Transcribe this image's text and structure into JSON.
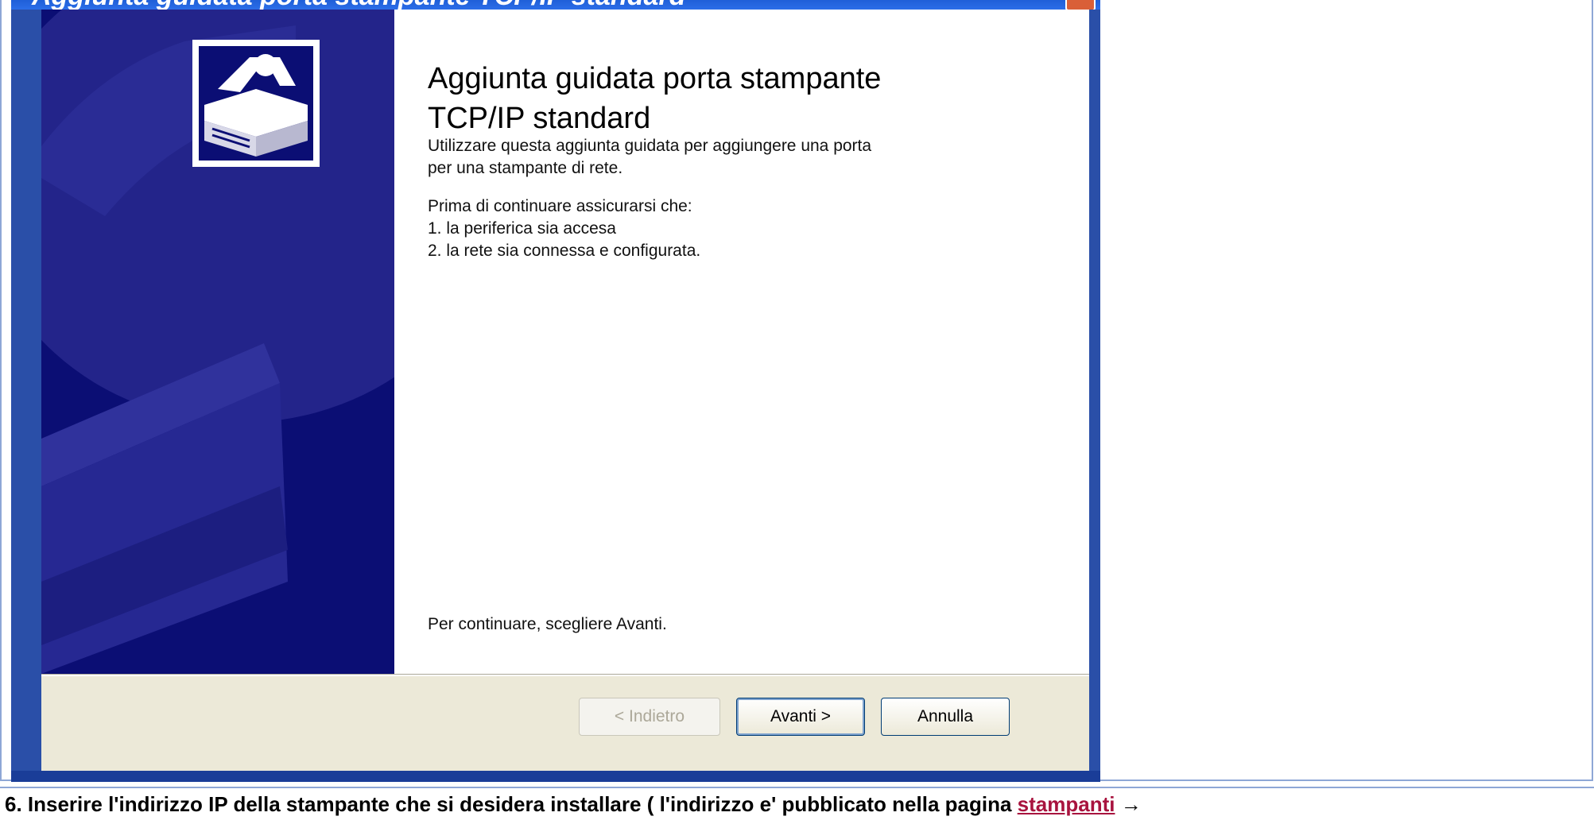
{
  "window": {
    "title": "Aggiunta guidata porta stampante TCP/IP standard"
  },
  "wizard": {
    "heading_line1": "Aggiunta guidata porta stampante",
    "heading_line2": "TCP/IP standard",
    "intro_line1": "Utilizzare questa aggiunta guidata per aggiungere una porta",
    "intro_line2": "per una stampante di rete.",
    "prereq_heading": "Prima di continuare assicurarsi che:",
    "prereq_1": "1. la periferica sia accesa",
    "prereq_2": "2. la rete sia connessa e configurata.",
    "continue_text": "Per continuare, scegliere Avanti."
  },
  "buttons": {
    "back": "< Indietro",
    "next": "Avanti >",
    "cancel": "Annulla"
  },
  "icons": {
    "banner": "printer-icon",
    "close": "close-icon"
  },
  "colors": {
    "banner_bg": "#0b0e74",
    "titlebar": "#2b6ee8",
    "link": "#a8133e"
  },
  "footer": {
    "text": "6. Inserire l'indirizzo IP della stampante che si desidera installare ( l'indirizzo e' pubblicato nella pagina ",
    "link": "stampanti",
    "arrow": " →"
  }
}
